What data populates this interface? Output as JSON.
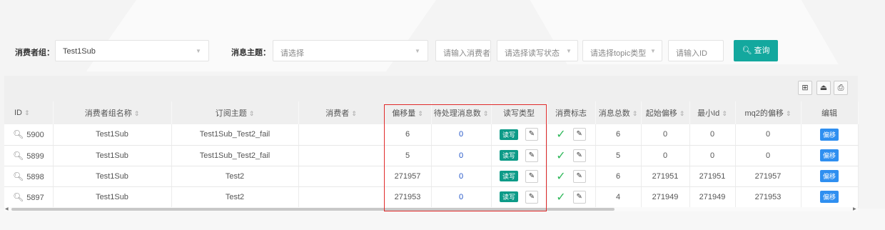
{
  "filters": {
    "consumer_group_label": "消费者组：",
    "consumer_group_value": "Test1Sub",
    "topic_label": "消息主题：",
    "topic_placeholder": "请选择",
    "consumer_placeholder": "请输入消费者",
    "rw_status_placeholder": "请选择读写状态",
    "topic_type_placeholder": "请选择topic类型",
    "id_placeholder": "请输入ID",
    "query_button": "查询"
  },
  "toolbar": {
    "icons": [
      "columns-icon",
      "export-icon",
      "print-icon"
    ]
  },
  "table": {
    "headers": {
      "id": "ID",
      "group_name": "消费者组名称",
      "topic": "订阅主题",
      "consumer": "消费者",
      "offset": "偏移量",
      "pending": "待处理消息数",
      "rw_type": "读写类型",
      "consume_flag": "消费标志",
      "total": "消息总数",
      "start_offset": "起始偏移",
      "min_id": "最小Id",
      "mq2_offset": "mq2的偏移",
      "edit": "编辑"
    },
    "rows": [
      {
        "id": "5900",
        "group": "Test1Sub",
        "topic": "Test1Sub_Test2_fail",
        "consumer": "",
        "offset": "6",
        "pending": "0",
        "rw": "读写",
        "total": "6",
        "start": "0",
        "min_id": "0",
        "mq2": "0",
        "edit": "偏移"
      },
      {
        "id": "5899",
        "group": "Test1Sub",
        "topic": "Test1Sub_Test2_fail",
        "consumer": "",
        "offset": "5",
        "pending": "0",
        "rw": "读写",
        "total": "5",
        "start": "0",
        "min_id": "0",
        "mq2": "0",
        "edit": "偏移"
      },
      {
        "id": "5898",
        "group": "Test1Sub",
        "topic": "Test2",
        "consumer": "",
        "offset": "271957",
        "pending": "0",
        "rw": "读写",
        "total": "6",
        "start": "271951",
        "min_id": "271951",
        "mq2": "271957",
        "edit": "偏移"
      },
      {
        "id": "5897",
        "group": "Test1Sub",
        "topic": "Test2",
        "consumer": "",
        "offset": "271953",
        "pending": "0",
        "rw": "读写",
        "total": "4",
        "start": "271949",
        "min_id": "271949",
        "mq2": "271953",
        "edit": "偏移"
      }
    ]
  },
  "colors": {
    "accent": "#13a89e",
    "rw_badge": "#0d9b88",
    "edit_badge": "#2f8ff0",
    "highlight": "#e12b2b",
    "check": "#2fb85a"
  }
}
